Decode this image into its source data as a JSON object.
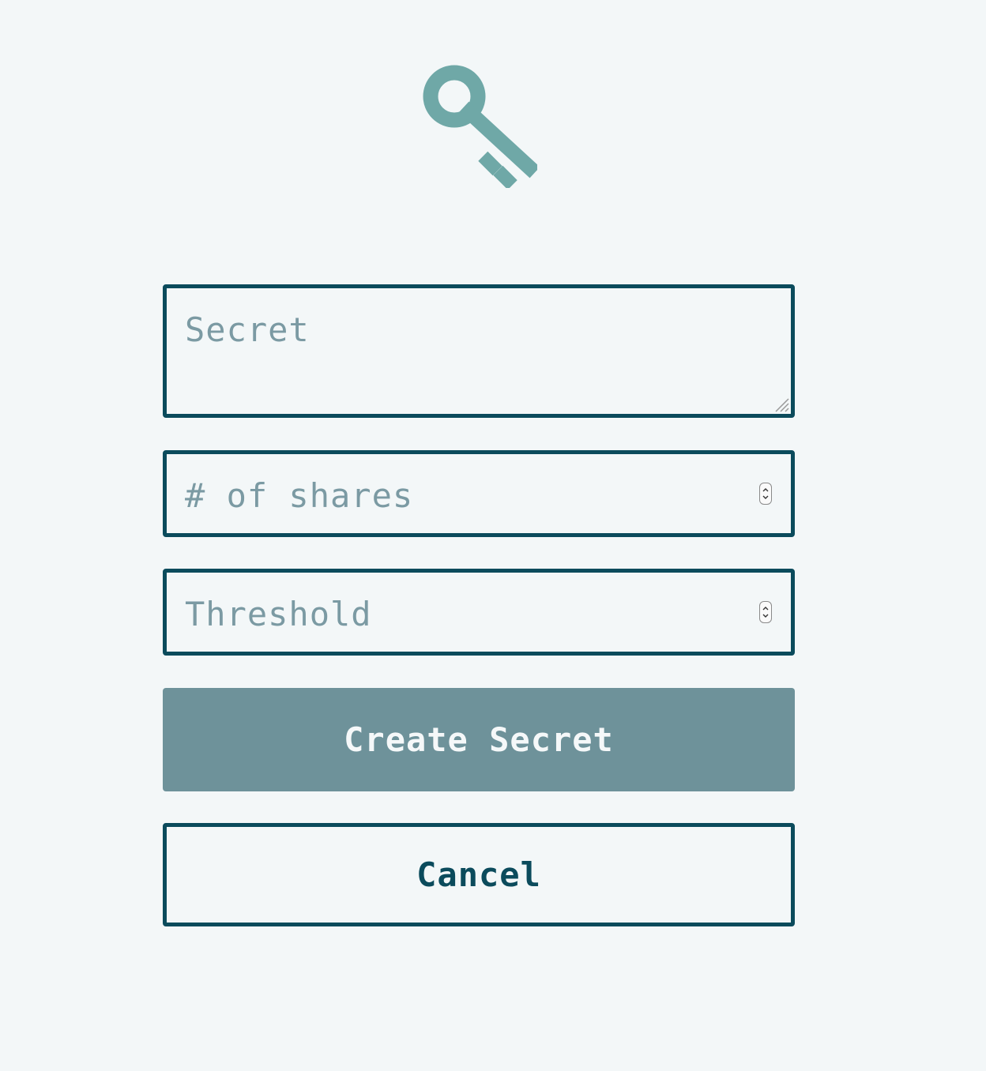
{
  "logo": {
    "icon": "key-icon",
    "color": "#6fa8a7"
  },
  "form": {
    "secret": {
      "placeholder": "Secret"
    },
    "shares": {
      "placeholder": "# of shares"
    },
    "threshold": {
      "placeholder": "Threshold"
    },
    "create_button": "Create Secret",
    "cancel_button": "Cancel"
  },
  "colors": {
    "background": "#f3f7f8",
    "border": "#0b4b5c",
    "placeholder": "#7b9aa3",
    "primary_button": "#6e929a"
  }
}
